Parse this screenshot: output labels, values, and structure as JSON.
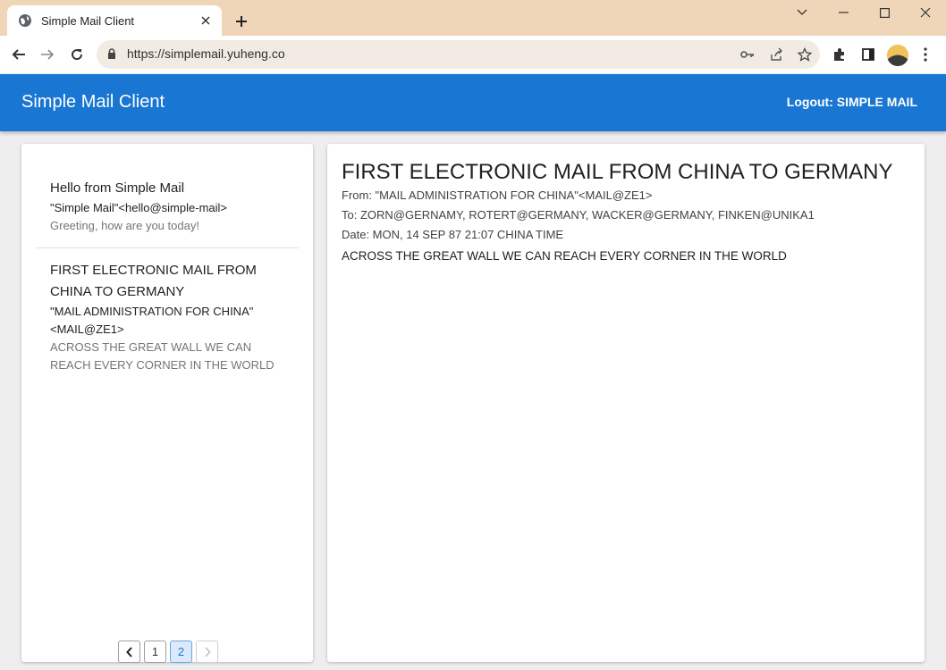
{
  "browser": {
    "tab_title": "Simple Mail Client",
    "url": "https://simplemail.yuheng.co"
  },
  "app": {
    "title": "Simple Mail Client",
    "logout_label": "Logout: SIMPLE MAIL"
  },
  "mail_list": {
    "items": [
      {
        "subject": "Hello from Simple Mail",
        "from": "\"Simple Mail\"<hello@simple-mail>",
        "preview": "Greeting, how are you today!"
      },
      {
        "subject_line1": "FIRST ELECTRONIC MAIL FROM",
        "subject_line2": "CHINA TO GERMANY",
        "from_line1": "\"MAIL ADMINISTRATION FOR CHINA\"",
        "from_line2": "<MAIL@ZE1>",
        "preview_line1": "ACROSS THE GREAT WALL WE CAN",
        "preview_line2": "REACH EVERY CORNER IN THE WORLD"
      }
    ]
  },
  "pagination": {
    "pages": [
      "1",
      "2"
    ],
    "current": "2"
  },
  "detail": {
    "subject": "FIRST ELECTRONIC MAIL FROM CHINA TO GERMANY",
    "from": "From: \"MAIL ADMINISTRATION FOR CHINA\"<MAIL@ZE1>",
    "to": "To: ZORN@GERNAMY, ROTERT@GERMANY, WACKER@GERMANY, FINKEN@UNIKA1",
    "date": "Date: MON, 14 SEP 87 21:07 CHINA TIME",
    "body": "ACROSS THE GREAT WALL WE CAN REACH EVERY CORNER IN THE WORLD"
  },
  "colors": {
    "app_bar": "#1976d2",
    "tabstrip": "#f0d6b8"
  }
}
